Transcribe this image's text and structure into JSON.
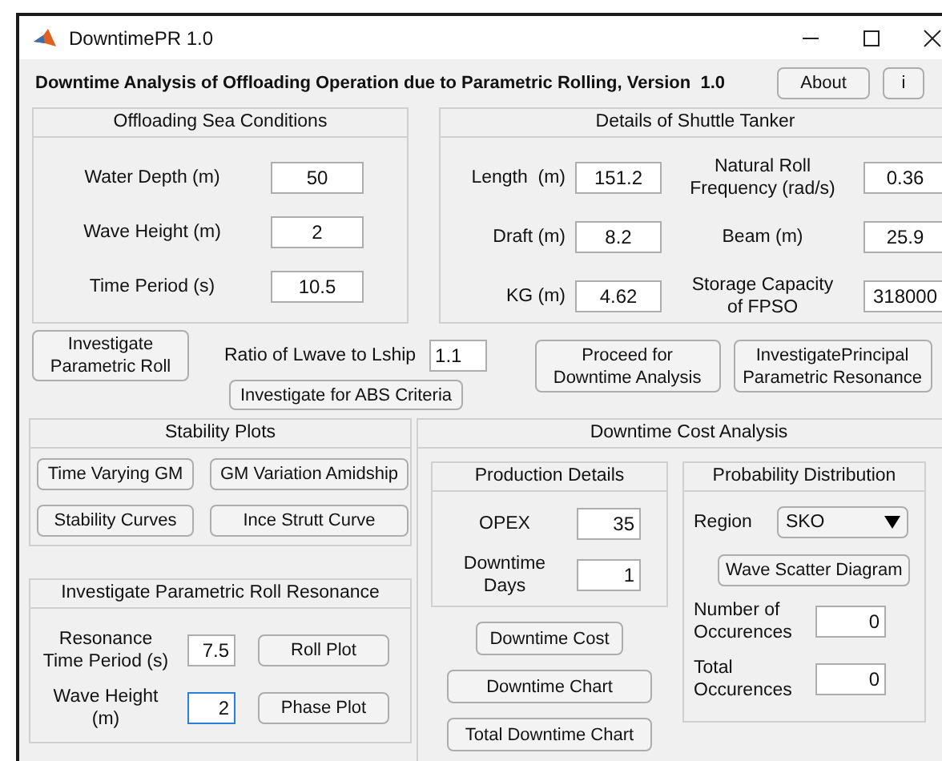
{
  "window": {
    "title": "DowntimePR 1.0"
  },
  "heading": "Downtime Analysis of Offloading Operation due to Parametric Rolling, Version  1.0",
  "header_buttons": [
    "About",
    "i"
  ],
  "sea_conditions": {
    "title": "Offloading Sea Conditions",
    "fields": [
      {
        "label": "Water Depth (m)",
        "value": "50"
      },
      {
        "label": "Wave Height (m)",
        "value": "2"
      },
      {
        "label": "Time Period (s)",
        "value": "10.5"
      }
    ]
  },
  "shuttle_tanker": {
    "title": "Details of Shuttle Tanker",
    "rows": [
      {
        "fields": [
          {
            "label": "Length  (m)",
            "value": "151.2"
          },
          {
            "label": "Natural Roll\nFrequency (rad/s)",
            "value": "0.36"
          }
        ]
      },
      {
        "fields": [
          {
            "label": "Draft (m)",
            "value": "8.2"
          },
          {
            "label": "Beam (m)",
            "value": "25.9"
          }
        ]
      },
      {
        "fields": [
          {
            "label": "KG (m)",
            "value": "4.62"
          },
          {
            "label": "Storage Capacity\nof FPSO",
            "value": "318000"
          }
        ]
      }
    ]
  },
  "investigate_button": "Investigate\nParametric Roll",
  "ratio": {
    "label": "Ratio of Lwave to Lship",
    "value": "1.1"
  },
  "abs_button": "Investigate for ABS Criteria",
  "proceed_button": "Proceed for\nDowntime Analysis",
  "principal_button": "InvestigatePrincipal\nParametric Resonance",
  "stability_plots": {
    "title": "Stability Plots",
    "buttons": [
      "Time Varying GM",
      "GM Variation Amidship",
      "Stability Curves",
      "Ince Strutt Curve"
    ]
  },
  "resonance": {
    "title": "Investigate Parametric Roll Resonance",
    "fields": [
      {
        "label": "Resonance\nTime Period (s)",
        "value": "7.5",
        "focused": false,
        "button": "Roll Plot"
      },
      {
        "label": "Wave Height\n(m)",
        "value": "2",
        "focused": true,
        "button": "Phase Plot"
      }
    ]
  },
  "downtime_cost": {
    "title": "Downtime Cost Analysis",
    "production": {
      "title": "Production Details",
      "fields": [
        {
          "label": "OPEX",
          "value": "35"
        },
        {
          "label": "Downtime\nDays",
          "value": "1"
        }
      ]
    },
    "buttons": [
      "Downtime Cost",
      "Downtime Chart",
      "Total Downtime Chart"
    ],
    "probability": {
      "title": "Probability Distribution",
      "region": {
        "label": "Region",
        "value": "SKO"
      },
      "button": "Wave Scatter Diagram",
      "fields": [
        {
          "label": "Number of\nOccurences",
          "value": "0"
        },
        {
          "label": "Total\nOccurences",
          "value": "0"
        }
      ]
    }
  }
}
